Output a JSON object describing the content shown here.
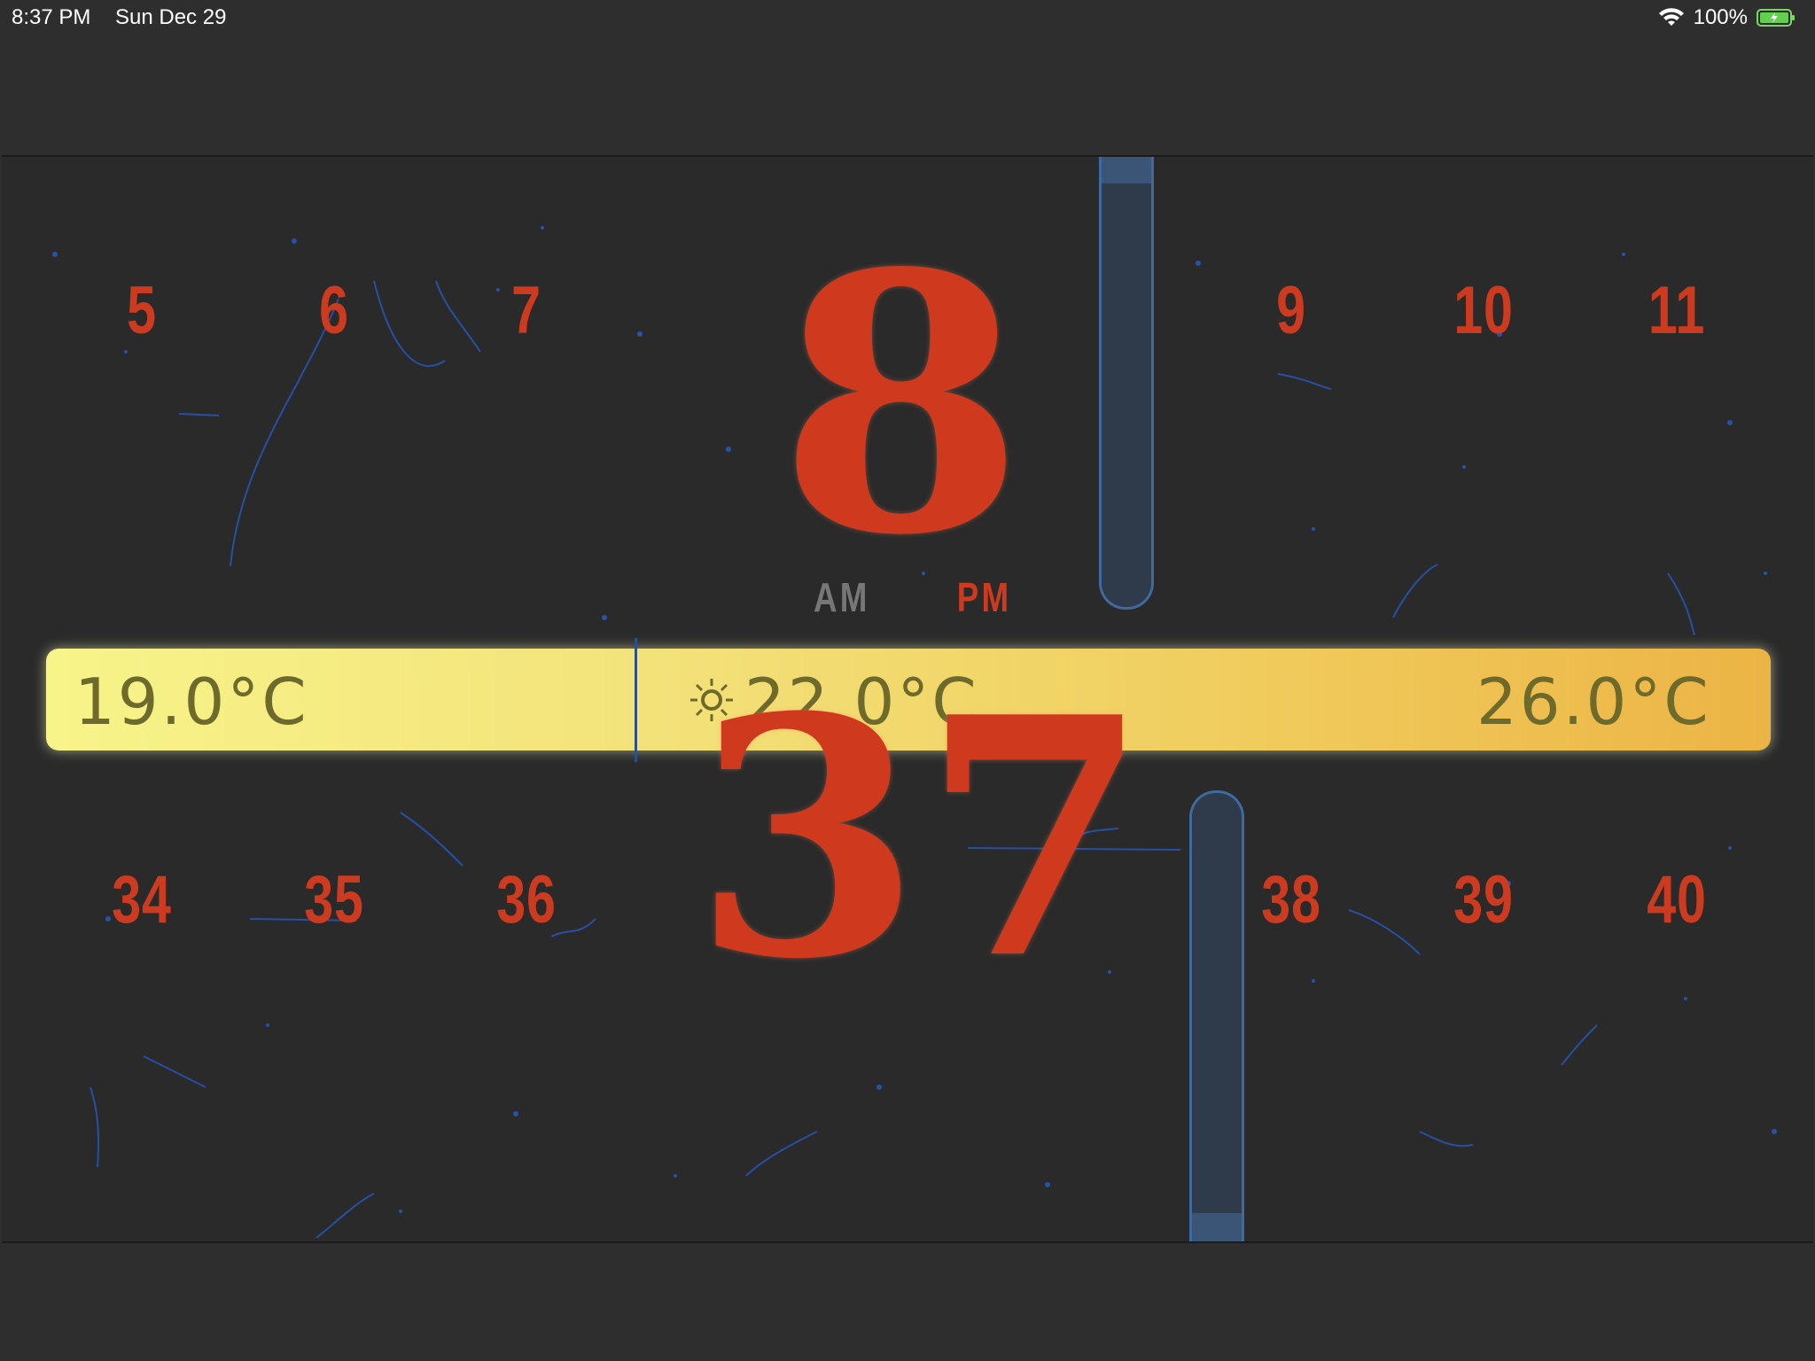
{
  "status_bar": {
    "time": "8:37 PM",
    "date": "Sun Dec 29",
    "battery": "100%",
    "wifi_icon": "wifi-icon",
    "battery_icon": "battery-charging-icon"
  },
  "clock": {
    "hour_current": "8",
    "hours_before": [
      "5",
      "6",
      "7"
    ],
    "hours_after": [
      "9",
      "10",
      "11"
    ],
    "am_label": "AM",
    "pm_label": "PM",
    "minute_current": "37",
    "minutes_before": [
      "34",
      "35",
      "36"
    ],
    "minutes_after": [
      "38",
      "39",
      "40"
    ]
  },
  "temperature": {
    "low": "19.0°C",
    "current": "22.0°C",
    "high": "26.0°C",
    "icon": "sun-icon"
  },
  "colors": {
    "accent_red": "#cc3b20",
    "slider_blue": "#3f6aa0",
    "bar_yellow_start": "#f7f48a",
    "bar_yellow_end": "#ecb445"
  }
}
